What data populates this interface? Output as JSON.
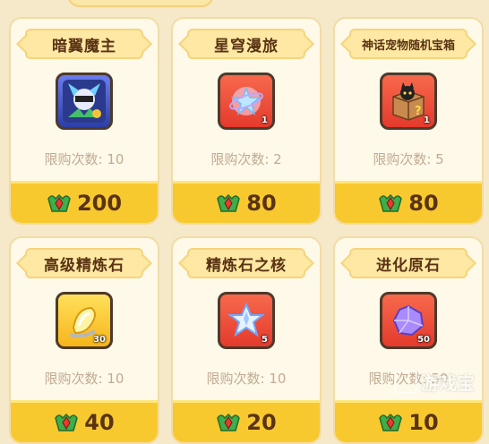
{
  "cards": [
    {
      "title": "暗翼魔主",
      "limit": "限购次数: 10",
      "price": "200",
      "item": "dark-wing-lord-portrait",
      "count": ""
    },
    {
      "title": "星穹漫旅",
      "limit": "限购次数: 2",
      "price": "80",
      "item": "star-travel-icon",
      "count": "1"
    },
    {
      "title": "神话宠物随机宝箱",
      "limit": "限购次数: 5",
      "price": "80",
      "item": "mystery-box-icon",
      "count": "1"
    },
    {
      "title": "高级精炼石",
      "limit": "限购次数: 10",
      "price": "40",
      "item": "refining-stone-icon",
      "count": "30"
    },
    {
      "title": "精炼石之核",
      "limit": "限购次数: 10",
      "price": "20",
      "item": "refining-core-icon",
      "count": "5"
    },
    {
      "title": "进化原石",
      "limit": "限购次数: 50",
      "price": "10",
      "item": "evolution-stone-icon",
      "count": "50"
    }
  ],
  "watermark": "游戏宝",
  "colors": {
    "price_bar": "#f8c92e",
    "card_bg": "#fff9e9",
    "text_dark": "#5a3314"
  }
}
